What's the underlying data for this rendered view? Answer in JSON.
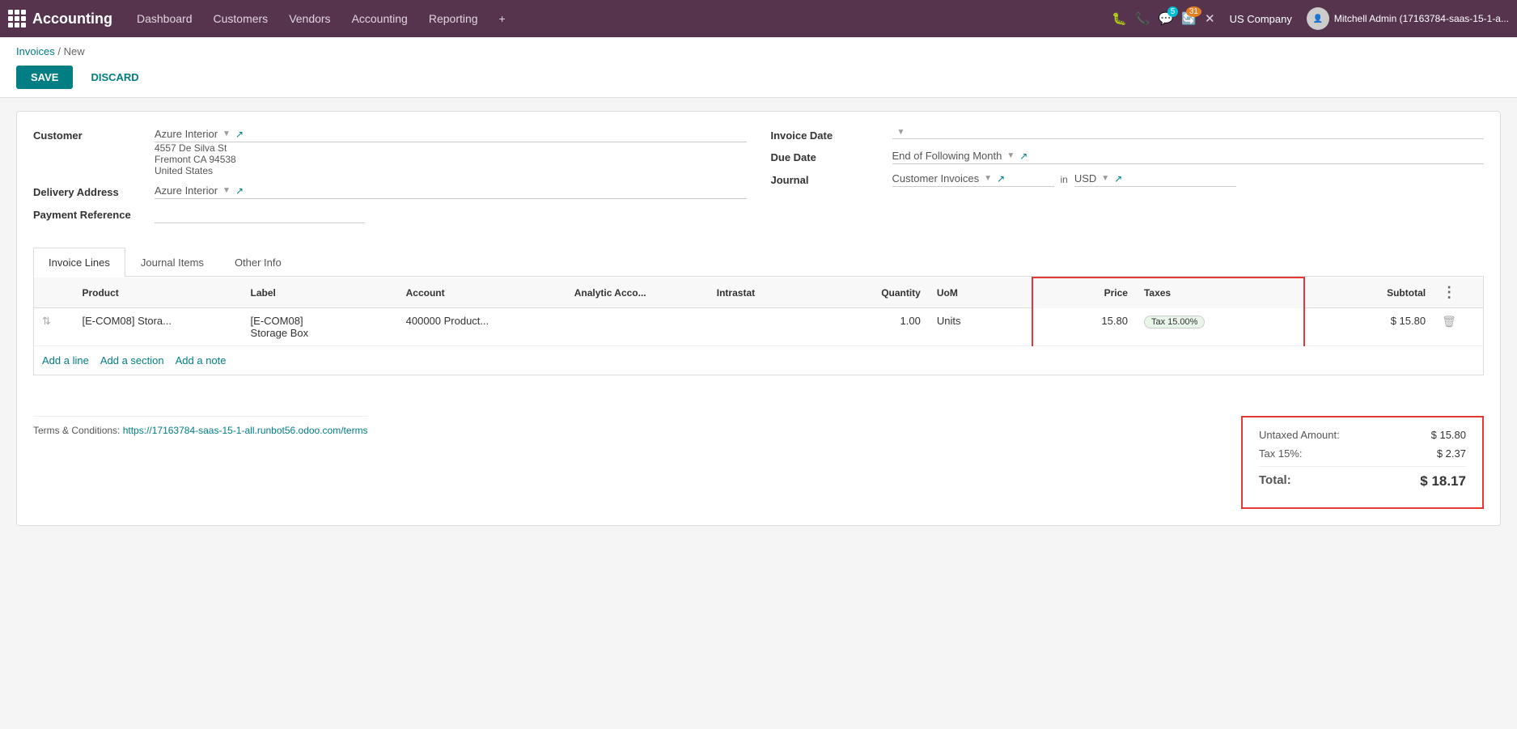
{
  "brand": {
    "name": "Accounting"
  },
  "nav": {
    "items": [
      {
        "label": "Dashboard",
        "active": false
      },
      {
        "label": "Customers",
        "active": false
      },
      {
        "label": "Vendors",
        "active": false
      },
      {
        "label": "Accounting",
        "active": false
      },
      {
        "label": "Reporting",
        "active": false
      }
    ],
    "add_icon": "+",
    "company": "US Company",
    "user": "Mitchell Admin (17163784-saas-15-1-a..."
  },
  "notifications": {
    "messages_count": "5",
    "activity_count": "31"
  },
  "breadcrumb": {
    "parent": "Invoices",
    "separator": "/",
    "current": "New"
  },
  "actions": {
    "save_label": "SAVE",
    "discard_label": "DISCARD"
  },
  "form": {
    "customer_label": "Customer",
    "customer_value": "Azure Interior",
    "address_line1": "4557 De Silva St",
    "address_line2": "Fremont CA 94538",
    "address_line3": "United States",
    "delivery_address_label": "Delivery Address",
    "delivery_address_value": "Azure Interior",
    "payment_reference_label": "Payment Reference",
    "invoice_date_label": "Invoice Date",
    "invoice_date_value": "",
    "due_date_label": "Due Date",
    "due_date_value": "End of Following Month",
    "journal_label": "Journal",
    "journal_value": "Customer Invoices",
    "journal_in": "in",
    "currency_value": "USD"
  },
  "tabs": [
    {
      "label": "Invoice Lines",
      "active": true
    },
    {
      "label": "Journal Items",
      "active": false
    },
    {
      "label": "Other Info",
      "active": false
    }
  ],
  "table": {
    "columns": [
      {
        "label": ""
      },
      {
        "label": "Product"
      },
      {
        "label": "Label"
      },
      {
        "label": "Account"
      },
      {
        "label": "Analytic Acco..."
      },
      {
        "label": "Intrastat"
      },
      {
        "label": "Quantity",
        "align": "right"
      },
      {
        "label": "UoM"
      },
      {
        "label": "Price",
        "highlight": true
      },
      {
        "label": "Taxes",
        "highlight": true
      },
      {
        "label": "Subtotal",
        "align": "right"
      },
      {
        "label": ""
      }
    ],
    "rows": [
      {
        "product": "[E-COM08] Stora...",
        "product_sub": "",
        "label": "[E-COM08]",
        "label_sub": "Storage Box",
        "account": "400000 Product...",
        "analytic": "",
        "intrastat": "",
        "quantity": "1.00",
        "uom": "Units",
        "price": "15.80",
        "tax": "Tax 15.00%",
        "subtotal": "$ 15.80"
      }
    ],
    "add_line": "Add a line",
    "add_section": "Add a section",
    "add_note": "Add a note"
  },
  "terms": {
    "label": "Terms & Conditions:",
    "link": "https://17163784-saas-15-1-all.runbot56.odoo.com/terms"
  },
  "totals": {
    "untaxed_label": "Untaxed Amount:",
    "untaxed_value": "$ 15.80",
    "tax_label": "Tax 15%:",
    "tax_value": "$ 2.37",
    "total_label": "Total:",
    "total_value": "$ 18.17"
  }
}
